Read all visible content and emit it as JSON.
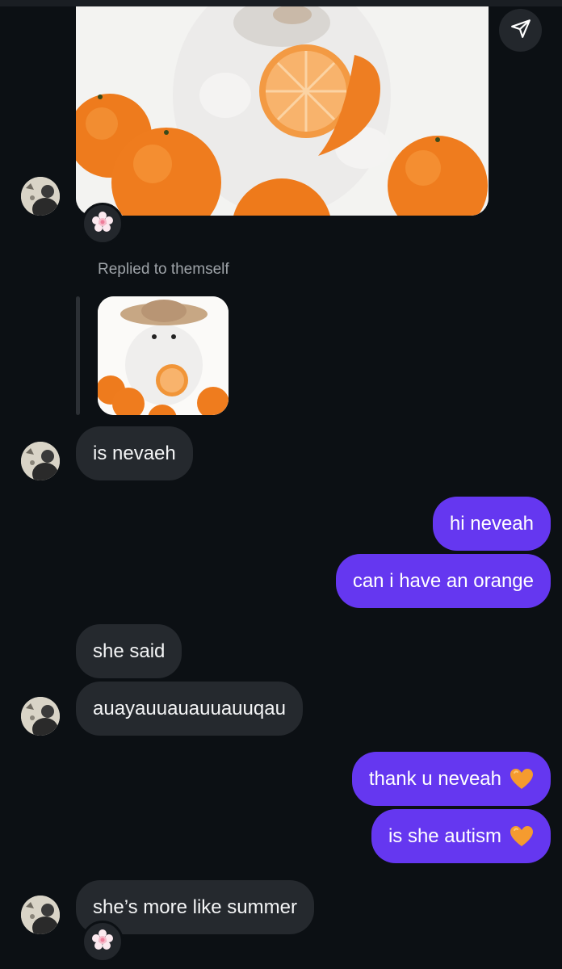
{
  "thread": {
    "reply_context": "Replied to themself",
    "messages": [
      {
        "id": "m1",
        "direction": "incoming",
        "text": "is nevaeh"
      },
      {
        "id": "m2",
        "direction": "outgoing",
        "text": "hi neveah"
      },
      {
        "id": "m3",
        "direction": "outgoing",
        "text": "can i have an orange"
      },
      {
        "id": "m4",
        "direction": "incoming",
        "text": "she said"
      },
      {
        "id": "m5",
        "direction": "incoming",
        "text": "auayauuauauuauuqau"
      },
      {
        "id": "m6",
        "direction": "outgoing",
        "text": "thank u neveah",
        "emoji": "orange-heart"
      },
      {
        "id": "m7",
        "direction": "outgoing",
        "text": "is she autism",
        "emoji": "orange-heart"
      },
      {
        "id": "m8",
        "direction": "incoming",
        "text": "she’s more like summer"
      }
    ]
  },
  "icons": {
    "share": "send-icon",
    "reaction": "flower-sticker-icon",
    "heart": "orange-heart-icon"
  },
  "colors": {
    "background": "#0c1014",
    "incoming_bubble": "#25292e",
    "outgoing_bubble": "#6537f0",
    "secondary_text": "#9ea3a8",
    "heart": "#f59b2f"
  }
}
